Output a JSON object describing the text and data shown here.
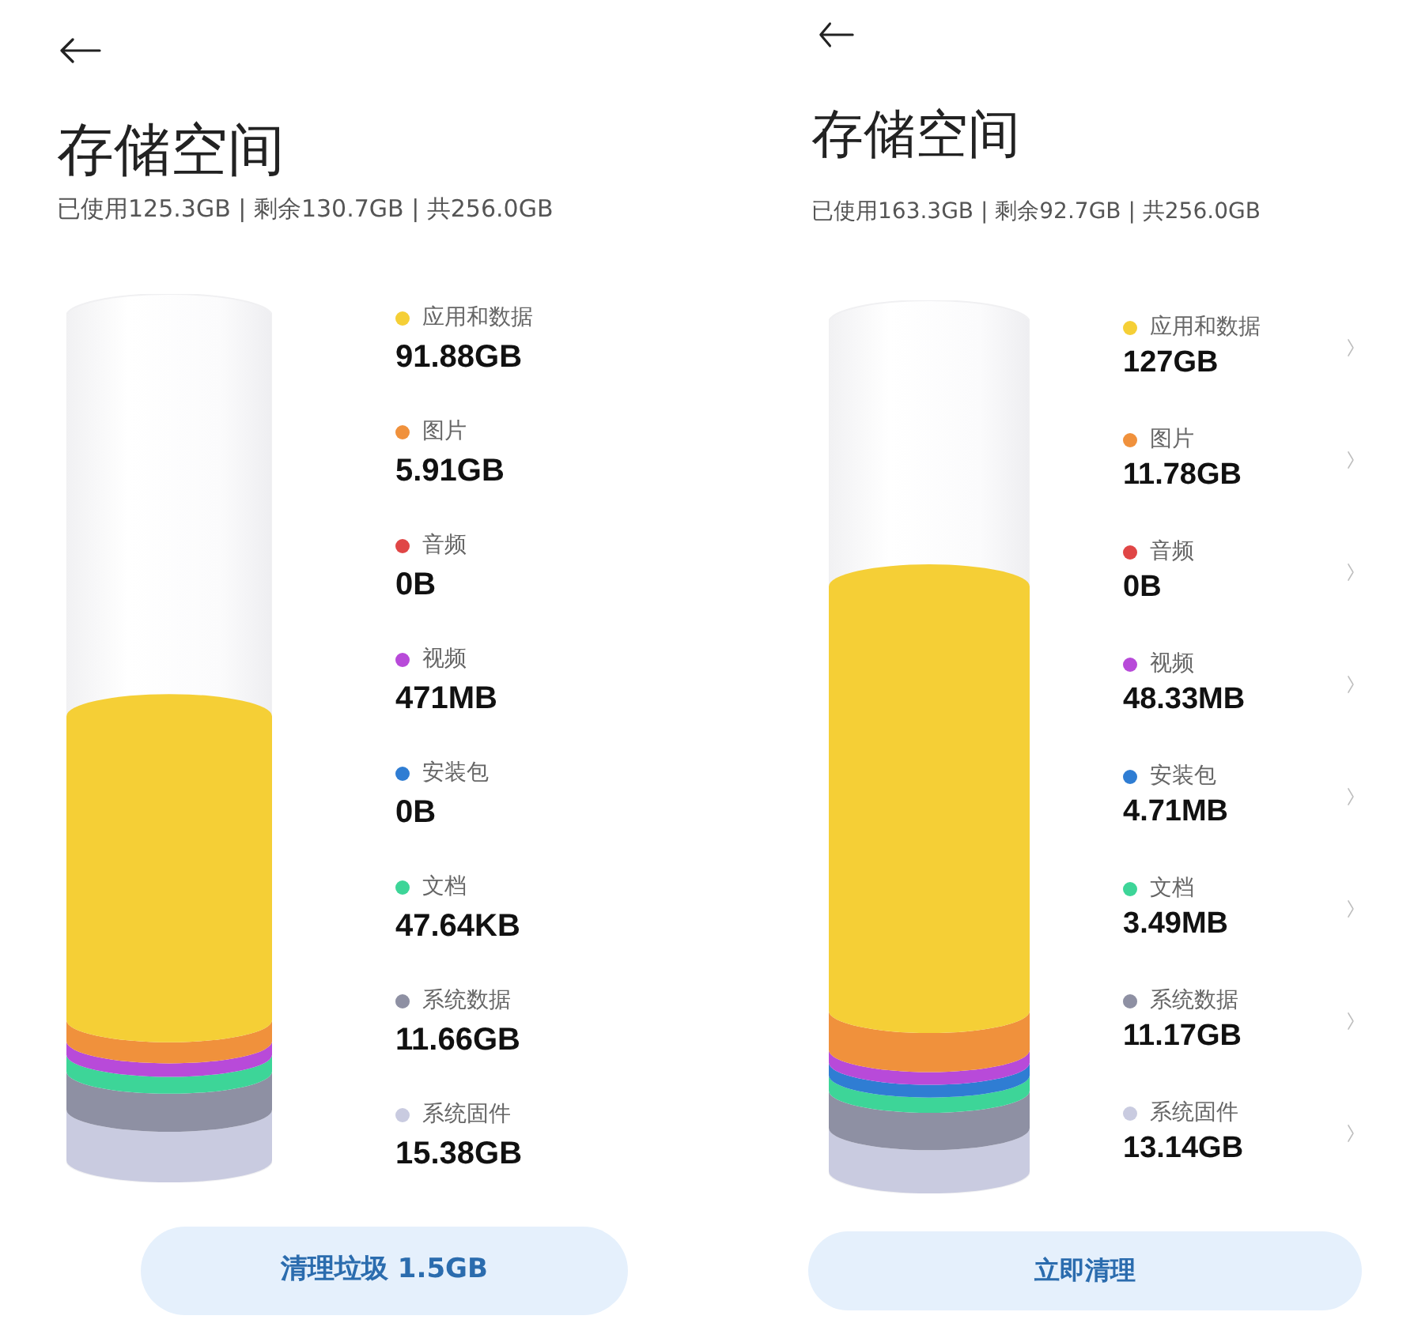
{
  "panels": [
    {
      "title": "存储空间",
      "summary": "已使用125.3GB | 剩余130.7GB | 共256.0GB",
      "chevrons": false,
      "categories": [
        {
          "label": "应用和数据",
          "value": "91.88GB",
          "color": "#f5cf36"
        },
        {
          "label": "图片",
          "value": "5.91GB",
          "color": "#f0913c"
        },
        {
          "label": "音频",
          "value": "0B",
          "color": "#e04646"
        },
        {
          "label": "视频",
          "value": "471MB",
          "color": "#b84ad9"
        },
        {
          "label": "安装包",
          "value": "0B",
          "color": "#2f7dd3"
        },
        {
          "label": "文档",
          "value": "47.64KB",
          "color": "#3dd598"
        },
        {
          "label": "系统数据",
          "value": "11.66GB",
          "color": "#8e90a3"
        },
        {
          "label": "系统固件",
          "value": "15.38GB",
          "color": "#c9cbe0"
        }
      ],
      "button": "清理垃圾 1.5GB"
    },
    {
      "title": "存储空间",
      "summary": "已使用163.3GB | 剩余92.7GB | 共256.0GB",
      "chevrons": true,
      "categories": [
        {
          "label": "应用和数据",
          "value": "127GB",
          "color": "#f5cf36"
        },
        {
          "label": "图片",
          "value": "11.78GB",
          "color": "#f0913c"
        },
        {
          "label": "音频",
          "value": "0B",
          "color": "#e04646"
        },
        {
          "label": "视频",
          "value": "48.33MB",
          "color": "#b84ad9"
        },
        {
          "label": "安装包",
          "value": "4.71MB",
          "color": "#2f7dd3"
        },
        {
          "label": "文档",
          "value": "3.49MB",
          "color": "#3dd598"
        },
        {
          "label": "系统数据",
          "value": "11.17GB",
          "color": "#8e90a3"
        },
        {
          "label": "系统固件",
          "value": "13.14GB",
          "color": "#c9cbe0"
        }
      ],
      "button": "立即清理"
    }
  ]
}
